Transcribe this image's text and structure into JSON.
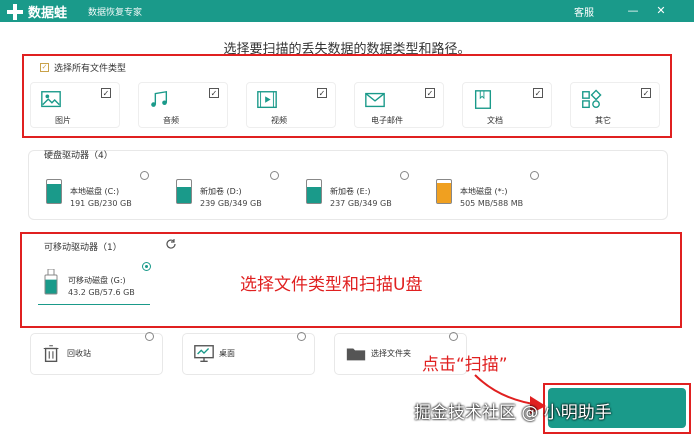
{
  "app": {
    "name": "数据蛙",
    "subtitle": "数据恢复专家",
    "service": "客服",
    "minimize": "—",
    "close": "✕"
  },
  "main": {
    "heading": "选择要扫描的丢失数据的数据类型和路径。"
  },
  "file_types": {
    "select_all_label": "选择所有文件类型",
    "items": [
      {
        "label": "图片",
        "icon": "image-icon",
        "checked": true
      },
      {
        "label": "音频",
        "icon": "audio-icon",
        "checked": true
      },
      {
        "label": "视频",
        "icon": "video-icon",
        "checked": true
      },
      {
        "label": "电子邮件",
        "icon": "email-icon",
        "checked": true
      },
      {
        "label": "文档",
        "icon": "document-icon",
        "checked": true
      },
      {
        "label": "其它",
        "icon": "other-icon",
        "checked": true
      }
    ]
  },
  "hard_drives": {
    "title": "硬盘驱动器（4）",
    "items": [
      {
        "name": "本地磁盘 (C:)",
        "size": "191 GB/230 GB",
        "fill": 0.83,
        "color": "#1a9a8a"
      },
      {
        "name": "新加卷 (D:)",
        "size": "239 GB/349 GB",
        "fill": 0.68,
        "color": "#1a9a8a"
      },
      {
        "name": "新加卷 (E:)",
        "size": "237 GB/349 GB",
        "fill": 0.68,
        "color": "#1a9a8a"
      },
      {
        "name": "本地磁盘 (*:)",
        "size": "505 MB/588 MB",
        "fill": 0.86,
        "color": "#f0a020"
      }
    ]
  },
  "removable": {
    "title": "可移动驱动器（1）",
    "refresh_icon": "refresh-icon",
    "item": {
      "name": "可移动磁盘 (G:)",
      "size": "43.2 GB/57.6 GB",
      "fill": 0.75,
      "selected": true
    }
  },
  "locations": [
    {
      "label": "回收站",
      "icon": "recycle-bin-icon"
    },
    {
      "label": "桌面",
      "icon": "desktop-icon"
    },
    {
      "label": "选择文件夹",
      "icon": "folder-icon"
    }
  ],
  "annotations": {
    "main": "选择文件类型和扫描U盘",
    "click_scan": "点击“扫描”",
    "watermark": "掘金技术社区 @ 小明助手"
  },
  "colors": {
    "accent": "#1a9a8a",
    "annotation": "#e02020",
    "orange": "#f0a020"
  }
}
